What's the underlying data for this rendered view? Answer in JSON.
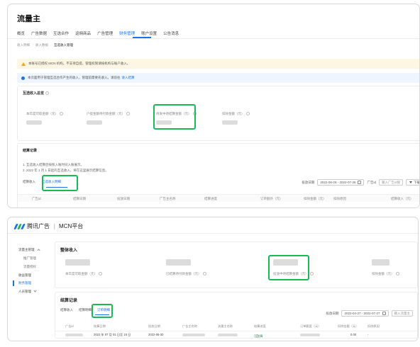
{
  "panel1": {
    "app_title": "流量主",
    "top_nav": [
      "概览",
      "广告数据",
      "互选合作",
      "返佣商品",
      "广告管理",
      "财务管理",
      "账户设置",
      "公告消息"
    ],
    "sub_nav": [
      "收入明细",
      "收入数据",
      "互选收入管理"
    ],
    "warning_text": "本账号已授权 MCN 机构，不支持自提，管理权限请按机构与账户收入。",
    "info_text": "本页面用于管理互选合作产生的收入，管理前需要先收入。请前往",
    "info_link": "收入结算",
    "summary": {
      "title": "互选收入总览",
      "metrics": [
        {
          "label": "本年度可取金额（元）"
        },
        {
          "label": "户提金额待付款金额（元）"
        },
        {
          "label": "待发中待结算金额（元）"
        },
        {
          "label": "扣除金额（元）"
        }
      ]
    },
    "records": {
      "title": "结算记录",
      "notes": [
        "1. 互选收入结算后按照入账时间入账展示。",
        "2. 2022 年 1 月 1 日起的互选收入，将在这里展示结算信息。"
      ],
      "tabs": [
        "结算收入",
        "互选收入明细"
      ],
      "date_label": "投放日期",
      "date_range": "2022-06-26 - 2022-07-26",
      "ad_id_label": "广告id",
      "ad_id_placeholder": "输入广告id搜",
      "download_label": "下载",
      "columns": [
        "广告id",
        "结算日期",
        "投放日期",
        "广告主名称",
        "结算进度",
        "订单额外（元）",
        "扣除金额（元）",
        "扣除原因",
        "结算收入（元）"
      ]
    }
  },
  "panel2": {
    "brand": "腾讯广告",
    "platform": "MCN平台",
    "sidebar": {
      "group1": "流量主管理",
      "items": [
        "推广管理",
        "流量授权",
        "收益管理",
        "财务管理"
      ],
      "group2": "人员管理"
    },
    "summary": {
      "title": "整体收入",
      "metrics": [
        {
          "label": "本年度可取金额（元）"
        },
        {
          "label": "已结算待付款金额（元）"
        },
        {
          "label": "投放中待结算金额（元）"
        },
        {
          "label": "扣除金额（元）"
        }
      ]
    },
    "records": {
      "title": "结算记录",
      "tabs": [
        "结算收入",
        "结算明细",
        "订单明细"
      ],
      "date_label": "投放日期",
      "date_range": "2022-04-27 - 2022-07-27",
      "search_placeholder": "输入流量主",
      "columns": [
        "广告id",
        "结算日期",
        "投放日期",
        "广告主名称",
        "流量主名称",
        "结算进度",
        "订单额度（元）",
        "扣除金额（元）",
        "扣除原因"
      ],
      "row": {
        "settle_date": "2022 年 07 月 01 日至 15 日",
        "delivery_date": "2022-06-30",
        "status": "已结算",
        "deduct": "0.00",
        "reason": "-"
      }
    }
  },
  "colors": {
    "accent": "#1a73e8",
    "highlight": "#19b955",
    "warn_bg": "#fdf6e3",
    "info_bg": "#eef5ff"
  }
}
